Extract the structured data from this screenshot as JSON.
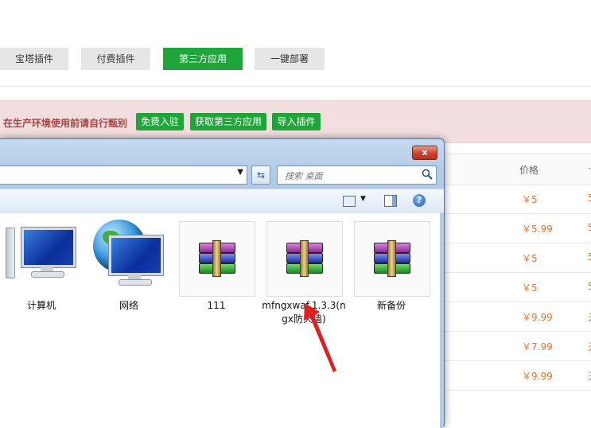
{
  "top_tabs": [
    {
      "label": "宝塔插件",
      "active": false
    },
    {
      "label": "付费插件",
      "active": false
    },
    {
      "label": "第三方应用",
      "active": true
    },
    {
      "label": "一键部署",
      "active": false
    }
  ],
  "warning": {
    "text": "在生产环境使用前请自行甄别",
    "buttons": [
      "免费入驻",
      "获取第三方应用",
      "导入插件"
    ]
  },
  "table": {
    "price_header": "价格",
    "prices": [
      "￥5",
      "￥5.99",
      "￥5",
      "￥5",
      "￥9.99",
      "￥7.99",
      "￥9.99"
    ],
    "extra_col": [
      "5",
      "5",
      "5",
      "5",
      "天",
      "天",
      "天"
    ]
  },
  "explorer": {
    "close_label": "x",
    "search_placeholder": "搜索 桌面",
    "items": [
      {
        "label": "计算机",
        "icon": "computer-icon"
      },
      {
        "label": "网络",
        "icon": "network-icon"
      },
      {
        "label": "111",
        "icon": "rar-archive-icon"
      },
      {
        "label": "mfngxwaf.1.3.3(ngx防火墙)",
        "icon": "rar-archive-icon"
      },
      {
        "label": "新备份",
        "icon": "rar-archive-icon"
      }
    ]
  },
  "colors": {
    "accent": "#20a53a",
    "price": "#fc6d26",
    "warning_bg": "#f2dede",
    "annotation_arrow": "#e02020"
  }
}
